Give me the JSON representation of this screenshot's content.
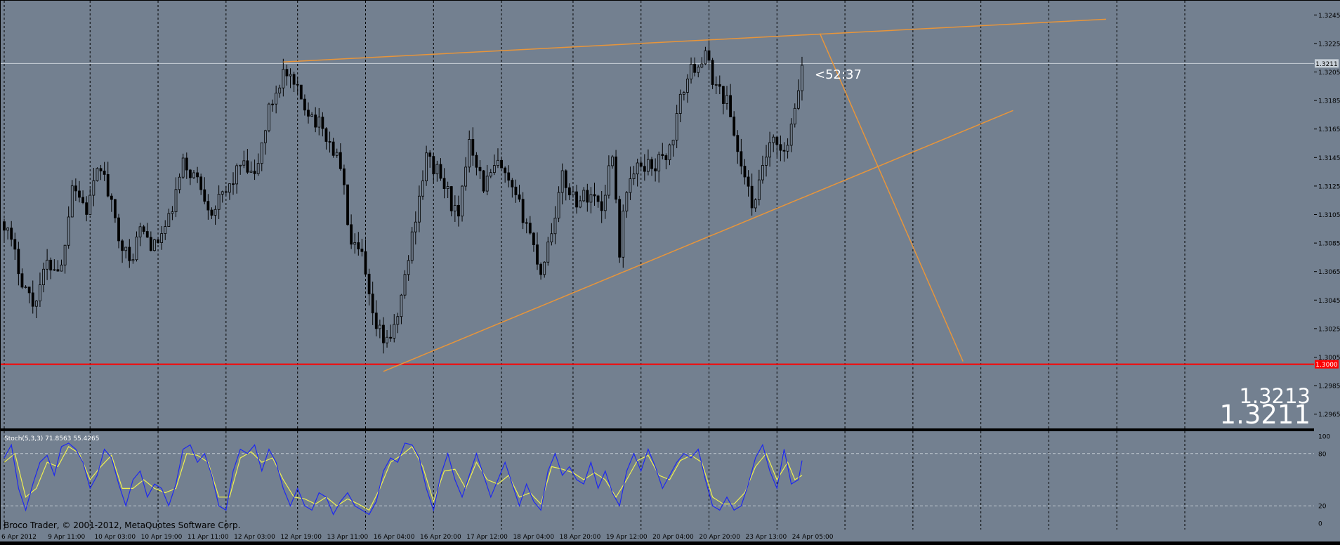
{
  "chart_data": {
    "type": "candlestick",
    "price_axis": {
      "range": [
        1.2955,
        1.3255
      ],
      "ticks": [
        "1.3245",
        "1.3225",
        "1.3205",
        "1.3185",
        "1.3165",
        "1.3145",
        "1.3125",
        "1.3105",
        "1.3085",
        "1.3065",
        "1.3045",
        "1.3025",
        "1.3005",
        "1.2985",
        "1.2965"
      ]
    },
    "time_axis": {
      "bar_count": 224,
      "labels": [
        {
          "bar": 0,
          "text": "6 Apr 2012"
        },
        {
          "bar": 13,
          "text": "9 Apr 11:00"
        },
        {
          "bar": 26,
          "text": "10 Apr 03:00"
        },
        {
          "bar": 39,
          "text": "10 Apr 19:00"
        },
        {
          "bar": 52,
          "text": "11 Apr 11:00"
        },
        {
          "bar": 65,
          "text": "12 Apr 03:00"
        },
        {
          "bar": 78,
          "text": "12 Apr 19:00"
        },
        {
          "bar": 91,
          "text": "13 Apr 11:00"
        },
        {
          "bar": 104,
          "text": "16 Apr 04:00"
        },
        {
          "bar": 117,
          "text": "16 Apr 20:00"
        },
        {
          "bar": 130,
          "text": "17 Apr 12:00"
        },
        {
          "bar": 143,
          "text": "18 Apr 04:00"
        },
        {
          "bar": 156,
          "text": "18 Apr 20:00"
        },
        {
          "bar": 169,
          "text": "19 Apr 12:00"
        },
        {
          "bar": 182,
          "text": "20 Apr 04:00"
        },
        {
          "bar": 195,
          "text": "20 Apr 20:00"
        },
        {
          "bar": 208,
          "text": "23 Apr 13:00"
        },
        {
          "bar": 221,
          "text": "24 Apr 05:00"
        }
      ],
      "separators": [
        0,
        24,
        43,
        62,
        82,
        101,
        120,
        139,
        159,
        178,
        197,
        216,
        235,
        254,
        273,
        292,
        311,
        330
      ]
    },
    "close_series": [
      {
        "bar": 0,
        "close": 1.31
      },
      {
        "bar": 5,
        "close": 1.306
      },
      {
        "bar": 8,
        "close": 1.3042
      },
      {
        "bar": 12,
        "close": 1.307
      },
      {
        "bar": 16,
        "close": 1.3068
      },
      {
        "bar": 19,
        "close": 1.3128
      },
      {
        "bar": 23,
        "close": 1.3108
      },
      {
        "bar": 27,
        "close": 1.314
      },
      {
        "bar": 31,
        "close": 1.31
      },
      {
        "bar": 35,
        "close": 1.307
      },
      {
        "bar": 38,
        "close": 1.3095
      },
      {
        "bar": 42,
        "close": 1.3082
      },
      {
        "bar": 46,
        "close": 1.31
      },
      {
        "bar": 50,
        "close": 1.314
      },
      {
        "bar": 54,
        "close": 1.313
      },
      {
        "bar": 58,
        "close": 1.3108
      },
      {
        "bar": 62,
        "close": 1.312
      },
      {
        "bar": 66,
        "close": 1.314
      },
      {
        "bar": 70,
        "close": 1.313
      },
      {
        "bar": 74,
        "close": 1.3178
      },
      {
        "bar": 78,
        "close": 1.3205
      },
      {
        "bar": 82,
        "close": 1.319
      },
      {
        "bar": 86,
        "close": 1.3175
      },
      {
        "bar": 90,
        "close": 1.316
      },
      {
        "bar": 94,
        "close": 1.314
      },
      {
        "bar": 97,
        "close": 1.3082
      },
      {
        "bar": 100,
        "close": 1.3075
      },
      {
        "bar": 103,
        "close": 1.303
      },
      {
        "bar": 106,
        "close": 1.3018
      },
      {
        "bar": 109,
        "close": 1.3022
      },
      {
        "bar": 112,
        "close": 1.306
      },
      {
        "bar": 115,
        "close": 1.3105
      },
      {
        "bar": 118,
        "close": 1.3145
      },
      {
        "bar": 121,
        "close": 1.3135
      },
      {
        "bar": 124,
        "close": 1.312
      },
      {
        "bar": 127,
        "close": 1.31
      },
      {
        "bar": 130,
        "close": 1.316
      },
      {
        "bar": 134,
        "close": 1.3125
      },
      {
        "bar": 138,
        "close": 1.314
      },
      {
        "bar": 142,
        "close": 1.312
      },
      {
        "bar": 146,
        "close": 1.31
      },
      {
        "bar": 150,
        "close": 1.3065
      },
      {
        "bar": 153,
        "close": 1.3095
      },
      {
        "bar": 156,
        "close": 1.313
      },
      {
        "bar": 160,
        "close": 1.3115
      },
      {
        "bar": 164,
        "close": 1.312
      },
      {
        "bar": 167,
        "close": 1.311
      },
      {
        "bar": 170,
        "close": 1.315
      },
      {
        "bar": 172,
        "close": 1.308
      },
      {
        "bar": 174,
        "close": 1.3125
      },
      {
        "bar": 178,
        "close": 1.314
      },
      {
        "bar": 182,
        "close": 1.314
      },
      {
        "bar": 186,
        "close": 1.315
      },
      {
        "bar": 190,
        "close": 1.3195
      },
      {
        "bar": 193,
        "close": 1.321
      },
      {
        "bar": 196,
        "close": 1.3215
      },
      {
        "bar": 199,
        "close": 1.3195
      },
      {
        "bar": 202,
        "close": 1.3185
      },
      {
        "bar": 205,
        "close": 1.315
      },
      {
        "bar": 208,
        "close": 1.312
      },
      {
        "bar": 210,
        "close": 1.311
      },
      {
        "bar": 212,
        "close": 1.314
      },
      {
        "bar": 215,
        "close": 1.3155
      },
      {
        "bar": 218,
        "close": 1.3145
      },
      {
        "bar": 221,
        "close": 1.3175
      },
      {
        "bar": 223,
        "close": 1.3211
      }
    ],
    "trendlines": [
      {
        "name": "upper-resistance",
        "from": {
          "bar": 78,
          "price": 1.3212
        },
        "to": {
          "bar": 308,
          "price": 1.3242
        },
        "color": "#E8953A"
      },
      {
        "name": "lower-support",
        "from": {
          "bar": 106,
          "price": 1.2995
        },
        "to": {
          "bar": 282,
          "price": 1.3178
        },
        "color": "#E8953A"
      },
      {
        "name": "projection",
        "from": {
          "bar": 228,
          "price": 1.3232
        },
        "to": {
          "bar": 268,
          "price": 1.3002
        },
        "color": "#E8953A"
      }
    ],
    "horizontal_lines": [
      {
        "name": "bid-line",
        "price": 1.3211,
        "color": "#C8D0D8",
        "label": "1.3211"
      },
      {
        "name": "support-level",
        "price": 1.3,
        "color": "#FF0000",
        "label": "1.3000"
      }
    ],
    "bar_timer": "<52:37",
    "ask_price": "1.3213",
    "bid_price": "1.3211",
    "stochastic": {
      "title": "Stoch(5,3,3) 71.8563 55.4265",
      "range": [
        0,
        100
      ],
      "levels": [
        80,
        20
      ],
      "ticks": [
        "100",
        "80",
        "20",
        "0"
      ],
      "main_color": "#1E28F0",
      "signal_color": "#F0F050",
      "main": [
        {
          "bar": 0,
          "value": 75
        },
        {
          "bar": 2,
          "value": 90
        },
        {
          "bar": 4,
          "value": 40
        },
        {
          "bar": 6,
          "value": 15
        },
        {
          "bar": 8,
          "value": 45
        },
        {
          "bar": 10,
          "value": 70
        },
        {
          "bar": 12,
          "value": 78
        },
        {
          "bar": 14,
          "value": 55
        },
        {
          "bar": 16,
          "value": 88
        },
        {
          "bar": 18,
          "value": 92
        },
        {
          "bar": 20,
          "value": 85
        },
        {
          "bar": 22,
          "value": 70
        },
        {
          "bar": 24,
          "value": 40
        },
        {
          "bar": 26,
          "value": 55
        },
        {
          "bar": 28,
          "value": 85
        },
        {
          "bar": 30,
          "value": 75
        },
        {
          "bar": 32,
          "value": 45
        },
        {
          "bar": 34,
          "value": 20
        },
        {
          "bar": 36,
          "value": 50
        },
        {
          "bar": 38,
          "value": 60
        },
        {
          "bar": 40,
          "value": 30
        },
        {
          "bar": 42,
          "value": 45
        },
        {
          "bar": 44,
          "value": 40
        },
        {
          "bar": 46,
          "value": 20
        },
        {
          "bar": 48,
          "value": 45
        },
        {
          "bar": 50,
          "value": 85
        },
        {
          "bar": 52,
          "value": 90
        },
        {
          "bar": 54,
          "value": 70
        },
        {
          "bar": 56,
          "value": 80
        },
        {
          "bar": 58,
          "value": 55
        },
        {
          "bar": 60,
          "value": 20
        },
        {
          "bar": 62,
          "value": 15
        },
        {
          "bar": 64,
          "value": 60
        },
        {
          "bar": 66,
          "value": 85
        },
        {
          "bar": 68,
          "value": 80
        },
        {
          "bar": 70,
          "value": 90
        },
        {
          "bar": 72,
          "value": 60
        },
        {
          "bar": 74,
          "value": 85
        },
        {
          "bar": 76,
          "value": 70
        },
        {
          "bar": 78,
          "value": 40
        },
        {
          "bar": 80,
          "value": 20
        },
        {
          "bar": 82,
          "value": 40
        },
        {
          "bar": 84,
          "value": 20
        },
        {
          "bar": 86,
          "value": 15
        },
        {
          "bar": 88,
          "value": 35
        },
        {
          "bar": 90,
          "value": 30
        },
        {
          "bar": 92,
          "value": 10
        },
        {
          "bar": 94,
          "value": 25
        },
        {
          "bar": 96,
          "value": 35
        },
        {
          "bar": 98,
          "value": 20
        },
        {
          "bar": 100,
          "value": 15
        },
        {
          "bar": 102,
          "value": 10
        },
        {
          "bar": 104,
          "value": 25
        },
        {
          "bar": 106,
          "value": 60
        },
        {
          "bar": 108,
          "value": 75
        },
        {
          "bar": 110,
          "value": 70
        },
        {
          "bar": 112,
          "value": 92
        },
        {
          "bar": 114,
          "value": 90
        },
        {
          "bar": 116,
          "value": 75
        },
        {
          "bar": 118,
          "value": 40
        },
        {
          "bar": 120,
          "value": 15
        },
        {
          "bar": 122,
          "value": 55
        },
        {
          "bar": 124,
          "value": 80
        },
        {
          "bar": 126,
          "value": 50
        },
        {
          "bar": 128,
          "value": 30
        },
        {
          "bar": 130,
          "value": 55
        },
        {
          "bar": 132,
          "value": 80
        },
        {
          "bar": 134,
          "value": 55
        },
        {
          "bar": 136,
          "value": 30
        },
        {
          "bar": 138,
          "value": 50
        },
        {
          "bar": 140,
          "value": 70
        },
        {
          "bar": 142,
          "value": 45
        },
        {
          "bar": 144,
          "value": 20
        },
        {
          "bar": 146,
          "value": 45
        },
        {
          "bar": 148,
          "value": 25
        },
        {
          "bar": 150,
          "value": 15
        },
        {
          "bar": 152,
          "value": 60
        },
        {
          "bar": 154,
          "value": 80
        },
        {
          "bar": 156,
          "value": 55
        },
        {
          "bar": 158,
          "value": 65
        },
        {
          "bar": 160,
          "value": 50
        },
        {
          "bar": 162,
          "value": 45
        },
        {
          "bar": 164,
          "value": 70
        },
        {
          "bar": 166,
          "value": 40
        },
        {
          "bar": 168,
          "value": 60
        },
        {
          "bar": 170,
          "value": 35
        },
        {
          "bar": 172,
          "value": 20
        },
        {
          "bar": 174,
          "value": 60
        },
        {
          "bar": 176,
          "value": 80
        },
        {
          "bar": 178,
          "value": 60
        },
        {
          "bar": 180,
          "value": 85
        },
        {
          "bar": 182,
          "value": 65
        },
        {
          "bar": 184,
          "value": 40
        },
        {
          "bar": 186,
          "value": 55
        },
        {
          "bar": 188,
          "value": 70
        },
        {
          "bar": 190,
          "value": 80
        },
        {
          "bar": 192,
          "value": 75
        },
        {
          "bar": 194,
          "value": 85
        },
        {
          "bar": 196,
          "value": 50
        },
        {
          "bar": 198,
          "value": 20
        },
        {
          "bar": 200,
          "value": 15
        },
        {
          "bar": 202,
          "value": 30
        },
        {
          "bar": 204,
          "value": 15
        },
        {
          "bar": 206,
          "value": 20
        },
        {
          "bar": 208,
          "value": 45
        },
        {
          "bar": 210,
          "value": 75
        },
        {
          "bar": 212,
          "value": 90
        },
        {
          "bar": 214,
          "value": 60
        },
        {
          "bar": 216,
          "value": 40
        },
        {
          "bar": 218,
          "value": 85
        },
        {
          "bar": 220,
          "value": 45
        },
        {
          "bar": 222,
          "value": 50
        },
        {
          "bar": 223,
          "value": 72
        }
      ],
      "signal": [
        {
          "bar": 0,
          "value": 70
        },
        {
          "bar": 3,
          "value": 80
        },
        {
          "bar": 6,
          "value": 30
        },
        {
          "bar": 9,
          "value": 40
        },
        {
          "bar": 12,
          "value": 70
        },
        {
          "bar": 15,
          "value": 65
        },
        {
          "bar": 18,
          "value": 88
        },
        {
          "bar": 21,
          "value": 80
        },
        {
          "bar": 24,
          "value": 50
        },
        {
          "bar": 27,
          "value": 65
        },
        {
          "bar": 30,
          "value": 78
        },
        {
          "bar": 33,
          "value": 40
        },
        {
          "bar": 36,
          "value": 40
        },
        {
          "bar": 39,
          "value": 50
        },
        {
          "bar": 42,
          "value": 40
        },
        {
          "bar": 45,
          "value": 35
        },
        {
          "bar": 48,
          "value": 40
        },
        {
          "bar": 51,
          "value": 80
        },
        {
          "bar": 54,
          "value": 78
        },
        {
          "bar": 57,
          "value": 70
        },
        {
          "bar": 60,
          "value": 30
        },
        {
          "bar": 63,
          "value": 30
        },
        {
          "bar": 66,
          "value": 75
        },
        {
          "bar": 69,
          "value": 82
        },
        {
          "bar": 72,
          "value": 70
        },
        {
          "bar": 75,
          "value": 75
        },
        {
          "bar": 78,
          "value": 50
        },
        {
          "bar": 81,
          "value": 30
        },
        {
          "bar": 84,
          "value": 28
        },
        {
          "bar": 87,
          "value": 22
        },
        {
          "bar": 90,
          "value": 30
        },
        {
          "bar": 93,
          "value": 20
        },
        {
          "bar": 96,
          "value": 28
        },
        {
          "bar": 99,
          "value": 22
        },
        {
          "bar": 102,
          "value": 15
        },
        {
          "bar": 105,
          "value": 40
        },
        {
          "bar": 108,
          "value": 70
        },
        {
          "bar": 111,
          "value": 78
        },
        {
          "bar": 114,
          "value": 88
        },
        {
          "bar": 117,
          "value": 65
        },
        {
          "bar": 120,
          "value": 25
        },
        {
          "bar": 123,
          "value": 60
        },
        {
          "bar": 126,
          "value": 62
        },
        {
          "bar": 129,
          "value": 40
        },
        {
          "bar": 132,
          "value": 70
        },
        {
          "bar": 135,
          "value": 50
        },
        {
          "bar": 138,
          "value": 45
        },
        {
          "bar": 141,
          "value": 55
        },
        {
          "bar": 144,
          "value": 30
        },
        {
          "bar": 147,
          "value": 35
        },
        {
          "bar": 150,
          "value": 22
        },
        {
          "bar": 153,
          "value": 65
        },
        {
          "bar": 156,
          "value": 62
        },
        {
          "bar": 159,
          "value": 58
        },
        {
          "bar": 162,
          "value": 50
        },
        {
          "bar": 165,
          "value": 58
        },
        {
          "bar": 168,
          "value": 50
        },
        {
          "bar": 171,
          "value": 30
        },
        {
          "bar": 174,
          "value": 50
        },
        {
          "bar": 177,
          "value": 72
        },
        {
          "bar": 180,
          "value": 78
        },
        {
          "bar": 183,
          "value": 55
        },
        {
          "bar": 186,
          "value": 50
        },
        {
          "bar": 189,
          "value": 72
        },
        {
          "bar": 192,
          "value": 78
        },
        {
          "bar": 195,
          "value": 70
        },
        {
          "bar": 198,
          "value": 30
        },
        {
          "bar": 201,
          "value": 22
        },
        {
          "bar": 204,
          "value": 22
        },
        {
          "bar": 207,
          "value": 35
        },
        {
          "bar": 210,
          "value": 65
        },
        {
          "bar": 213,
          "value": 80
        },
        {
          "bar": 216,
          "value": 50
        },
        {
          "bar": 219,
          "value": 70
        },
        {
          "bar": 221,
          "value": 50
        },
        {
          "bar": 223,
          "value": 55
        }
      ]
    }
  },
  "footer": {
    "copyright": "Broco Trader, © 2001-2012, MetaQuotes Software Corp."
  },
  "colors": {
    "plot_background": "#738090",
    "grid_separator": "#000000",
    "candle": "#000000",
    "axis_text": "#FFFFFF"
  }
}
